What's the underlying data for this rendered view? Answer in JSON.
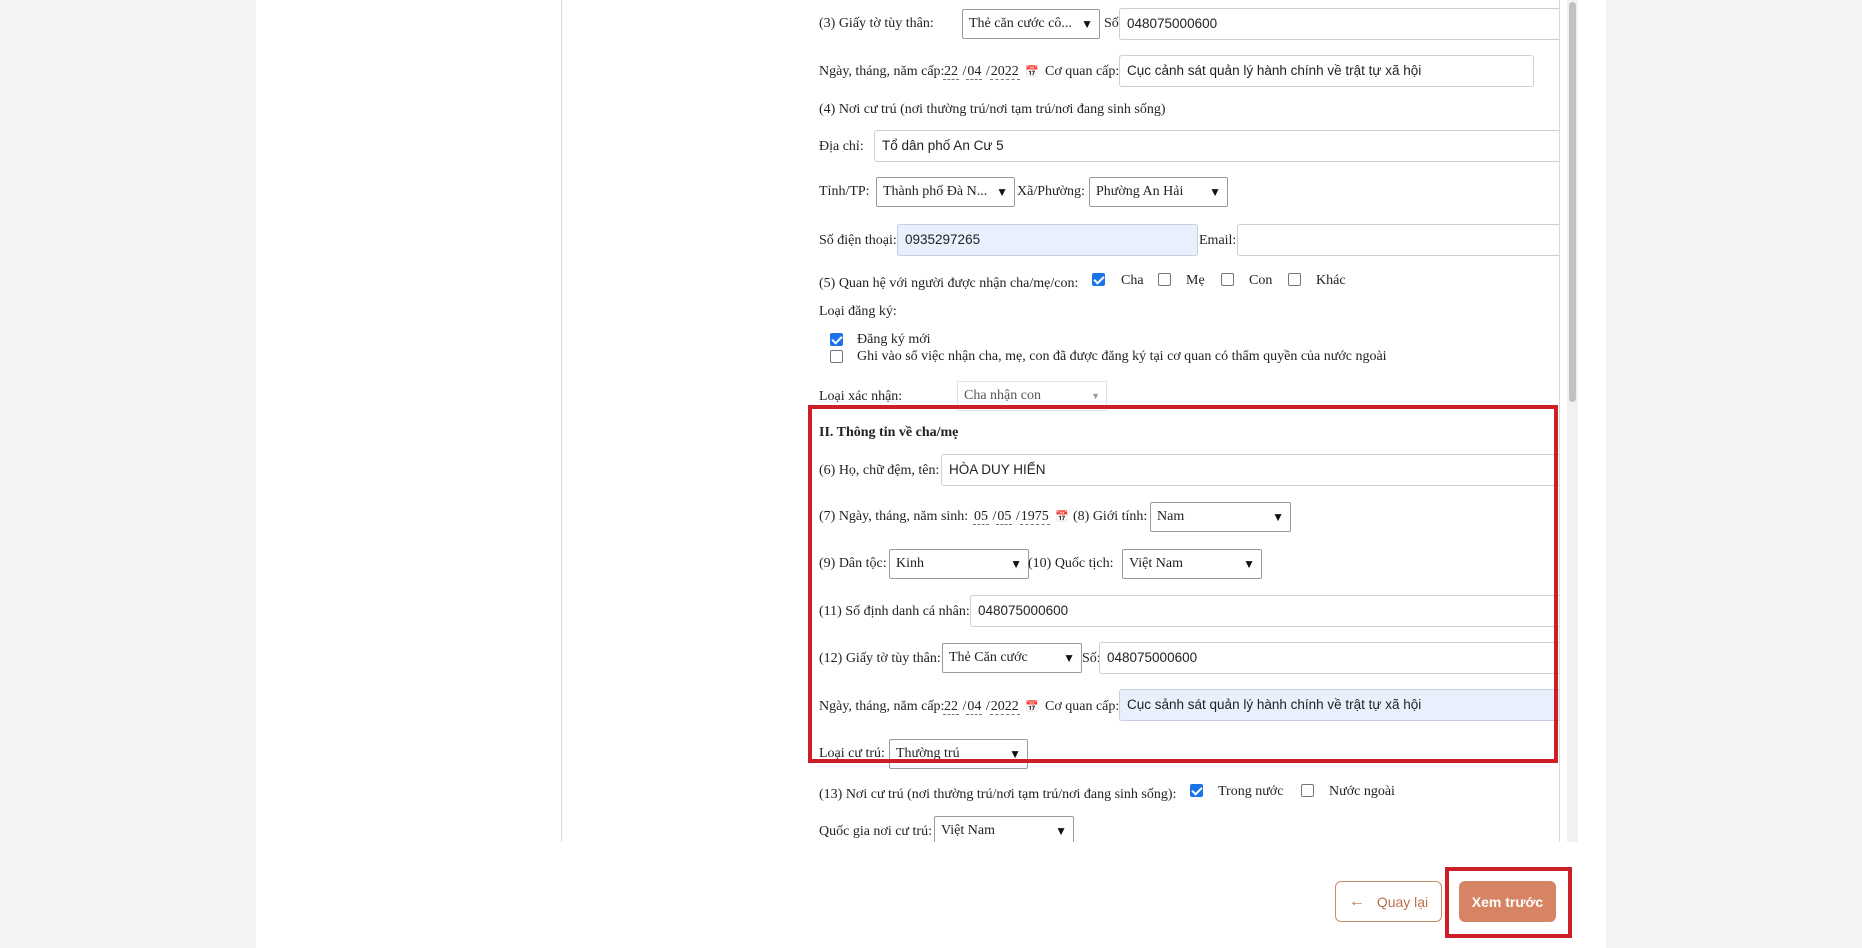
{
  "section_identity": {
    "id_doc_label": "(3) Giấy tờ tùy thân:",
    "id_doc_value": "Thẻ căn cước cô...",
    "number_label": "Số:",
    "number_value": "048075000600",
    "issue_date_label": "Ngày, tháng, năm cấp:",
    "issue_day": "22",
    "issue_month": "04",
    "issue_year": "2022",
    "authority_label": "Cơ quan cấp:",
    "authority_value": "Cục cảnh sát quản lý hành chính về trật tự xã hội"
  },
  "section_residence": {
    "heading": "(4) Nơi cư trú (nơi thường trú/nơi tạm trú/nơi đang sinh sống)",
    "address_label": "Địa chỉ:",
    "address_value": "Tổ dân phố An Cư 5",
    "province_label": "Tỉnh/TP:",
    "province_value": "Thành phố Đà N...",
    "ward_label": "Xã/Phường:",
    "ward_value": "Phường An Hải",
    "phone_label": "Số điện thoại:",
    "phone_value": "0935297265",
    "email_label": "Email:",
    "email_value": ""
  },
  "section_relation": {
    "label": "(5) Quan hệ với người được nhận cha/mẹ/con:",
    "options": [
      {
        "label": "Cha",
        "checked": true
      },
      {
        "label": "Mẹ",
        "checked": false
      },
      {
        "label": "Con",
        "checked": false
      },
      {
        "label": "Khác",
        "checked": false
      }
    ],
    "reg_type_label": "Loại đăng ký:",
    "reg_options": [
      {
        "label": "Đăng ký mới",
        "checked": true
      },
      {
        "label": "Ghi vào sổ việc nhận cha, mẹ, con đã được đăng ký tại cơ quan có thẩm quyền của nước ngoài",
        "checked": false
      }
    ],
    "confirm_type_label": "Loại xác nhận:",
    "confirm_type_value": "Cha nhận con"
  },
  "section_parent": {
    "heading": "II. Thông tin về cha/mẹ",
    "name_label": "(6) Họ, chữ đệm, tên:",
    "name_value": "HÒA DUY HIỂN",
    "dob_label": "(7) Ngày, tháng, năm sinh:",
    "dob_day": "05",
    "dob_month": "05",
    "dob_year": "1975",
    "gender_label": "(8) Giới tính:",
    "gender_value": "Nam",
    "ethnic_label": "(9) Dân tộc:",
    "ethnic_value": "Kinh",
    "nationality_label": "(10) Quốc tịch:",
    "nationality_value": "Việt Nam",
    "pid_label": "(11) Số định danh cá nhân:",
    "pid_value": "048075000600",
    "id_doc_label": "(12) Giấy tờ tùy thân:",
    "id_doc_value": "Thẻ Căn cước",
    "number_label": "Số:",
    "number_value": "048075000600",
    "issue_date_label": "Ngày, tháng, năm cấp:",
    "issue_day": "22",
    "issue_month": "04",
    "issue_year": "2022",
    "authority_label": "Cơ quan cấp:",
    "authority_value": "Cục sảnh sát quản lý hành chính về trật tự xã hội",
    "residence_type_label": "Loại cư trú:",
    "residence_type_value": "Thường trú"
  },
  "section_parent_residence": {
    "label": "(13) Nơi cư trú (nơi thường trú/nơi tạm trú/nơi đang sinh sống):",
    "domestic_label": "Trong nước",
    "domestic_checked": true,
    "foreign_label": "Nước ngoài",
    "foreign_checked": false,
    "country_label": "Quốc gia nơi cư trú:",
    "country_value": "Việt Nam"
  },
  "actions": {
    "back_label": "Quay lại",
    "preview_label": "Xem trước"
  },
  "icons": {
    "dropdown": "dropdown-arrow-icon",
    "calendar": "calendar-icon",
    "back_arrow": "arrow-left-icon"
  },
  "colors": {
    "highlight_border": "#cc1f27",
    "primary_button": "#d68463",
    "checkbox_checked": "#1a73e8",
    "autofill_bg": "#e8f0fe"
  }
}
